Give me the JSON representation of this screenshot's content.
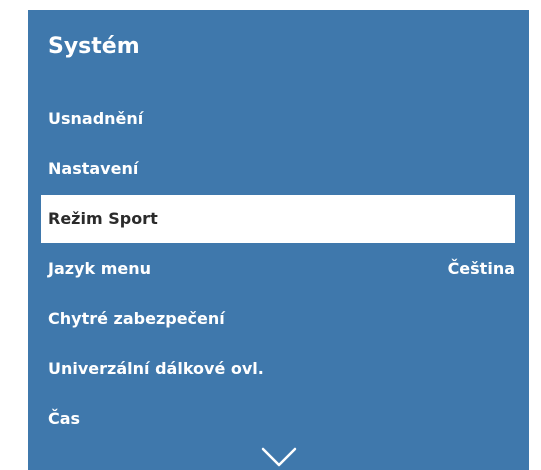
{
  "header": {
    "title": "Systém"
  },
  "menu": {
    "items": [
      {
        "label": "Usnadnění",
        "value": ""
      },
      {
        "label": "Nastavení",
        "value": ""
      },
      {
        "label": "Režim Sport",
        "value": ""
      },
      {
        "label": "Jazyk menu",
        "value": "Čeština"
      },
      {
        "label": "Chytré zabezpečení",
        "value": ""
      },
      {
        "label": "Univerzální dálkové ovl.",
        "value": ""
      },
      {
        "label": "Čas",
        "value": ""
      }
    ],
    "selected_index": 2
  },
  "icons": {
    "scroll": "chevron-down-icon"
  },
  "colors": {
    "panel_background": "#3f78ac",
    "selected_background": "#ffffff",
    "text": "#ffffff",
    "selected_text": "#2b2b2b"
  }
}
